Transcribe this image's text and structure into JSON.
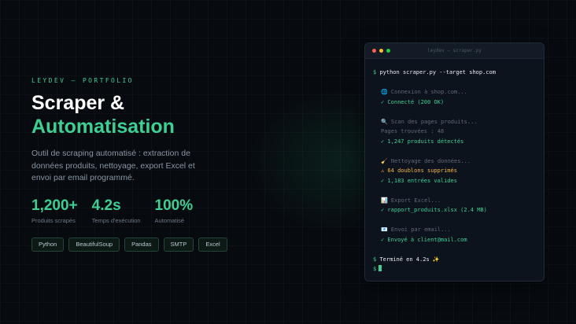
{
  "hero": {
    "kicker": "LEYDEV — PORTFOLIO",
    "title_line1": "Scraper &",
    "title_line2": "Automatisation",
    "description": "Outil de scraping automatisé : extraction de données produits, nettoyage, export Excel et envoi par email programmé."
  },
  "stats": [
    {
      "value": "1,200+",
      "label": "Produits scrapés"
    },
    {
      "value": "4.2s",
      "label": "Temps d'exécution"
    },
    {
      "value": "100%",
      "label": "Automatisé"
    }
  ],
  "tags": [
    "Python",
    "BeautifulSoup",
    "Pandas",
    "SMTP",
    "Excel"
  ],
  "terminal": {
    "title": "leydev — scraper.py",
    "prompt": "$",
    "command": "python scraper.py --target shop.com",
    "lines": {
      "connect": "🌐 Connexion à shop.com...",
      "connected": "✓ Connecté (200 OK)",
      "scan": "🔍 Scan des pages produits...",
      "pages": "Pages trouvées : 48",
      "detected": "✓ 1,247 produits détectés",
      "clean": "🧹 Nettoyage des données...",
      "duplicates": "⚠ 64 doublons supprimés",
      "valid": "✓ 1,183 entrées valides",
      "export": "📊 Export Excel...",
      "file": "✓ rapport_produits.xlsx (2.4 MB)",
      "email": "📧 Envoi par email...",
      "sent": "✓ Envoyé à client@mail.com",
      "finished": "Terminé en 4.2s ✨"
    }
  },
  "colors": {
    "accent": "#3ecf94",
    "warning": "#f5b63e",
    "background": "#070b10"
  },
  "icons": {
    "window_controls": [
      "close-dot",
      "minimize-dot",
      "maximize-dot"
    ]
  }
}
